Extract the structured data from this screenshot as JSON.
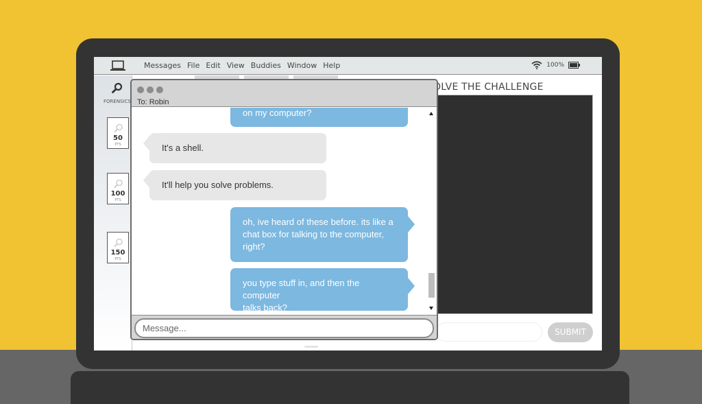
{
  "menubar": {
    "items": [
      "Messages",
      "File",
      "Edit",
      "View",
      "Buddies",
      "Window",
      "Help"
    ],
    "battery_percent": "100%",
    "icons": {
      "device": "laptop-icon",
      "wifi": "wifi-icon",
      "battery": "battery-icon"
    }
  },
  "sidebar": {
    "label": "FORENSICS",
    "challenges": [
      {
        "points": "50",
        "unit": "PTS"
      },
      {
        "points": "100",
        "unit": "PTS"
      },
      {
        "points": "150",
        "unit": "PTS"
      }
    ]
  },
  "main": {
    "title": "OLVE THE CHALLENGE",
    "submit_label": "SUBMIT"
  },
  "chat": {
    "to_label": "To: Robin",
    "messages": [
      {
        "from": "me",
        "text": "on my computer?"
      },
      {
        "from": "them",
        "text": "It's a shell."
      },
      {
        "from": "them",
        "text": "It'll help you solve problems."
      },
      {
        "from": "me",
        "lines": [
          "oh, ive heard of these before. its like a",
          "chat box for talking to the computer,",
          "right?"
        ]
      },
      {
        "from": "me",
        "lines": [
          "you type stuff in, and then the computer",
          "talks back?"
        ]
      }
    ],
    "input_placeholder": "Message..."
  },
  "colors": {
    "background": "#f1c232",
    "laptop": "#333333",
    "outgoing_bubble": "#7cb8e0",
    "incoming_bubble": "#e7e7e7"
  }
}
